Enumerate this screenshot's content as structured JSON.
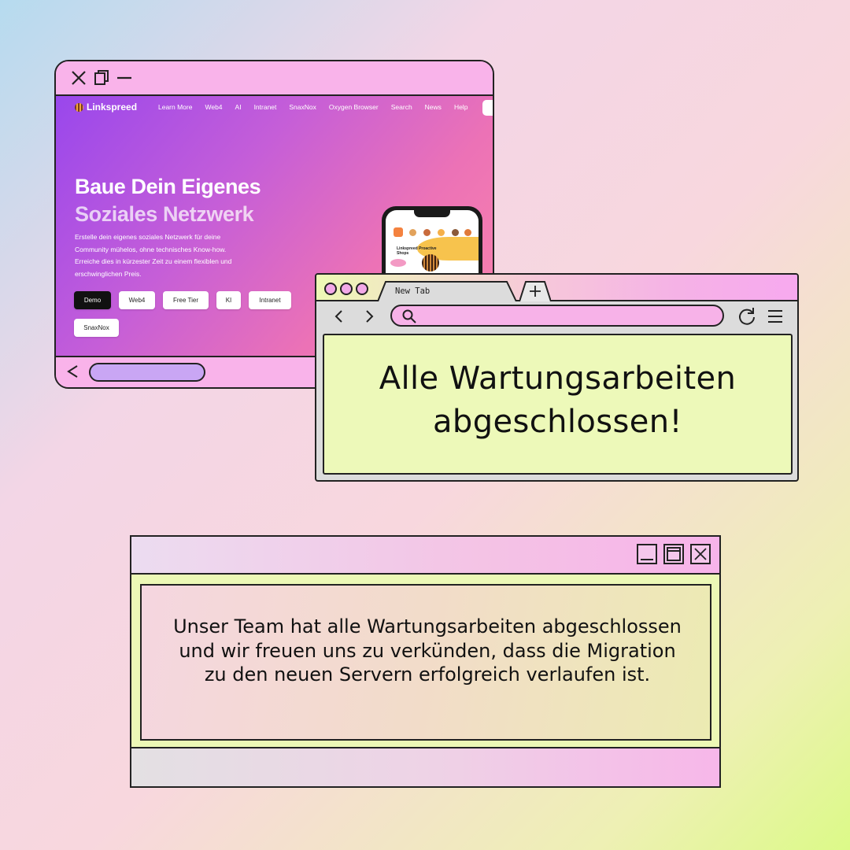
{
  "background": {
    "colors": [
      "#b6dbef",
      "#f8d7de",
      "#dcfa88"
    ]
  },
  "window_website": {
    "title_icons": [
      "close-icon",
      "restore-icon",
      "minimize-icon"
    ],
    "site": {
      "logo": "Linkspreed",
      "nav": [
        "Learn More",
        "Web4",
        "AI",
        "Intranet",
        "SnaxNox",
        "Oxygen Browser",
        "Search",
        "News",
        "Help"
      ],
      "hero_title_line1": "Baue Dein Eigenes",
      "hero_title_line2": "Soziales Netzwerk",
      "hero_text": "Erstelle dein eigenes soziales Netzwerk für deine Community mühelos, ohne technisches Know-how. Erreiche dies in kürzester Zeit zu einem flexiblen und erschwinglichen Preis.",
      "chips": [
        "Demo",
        "Web4",
        "Free Tier",
        "KI",
        "Intranet",
        "SnaxNox"
      ],
      "phone_label": "Linkspreed Proactive Shops"
    },
    "accent": "#f9b3ea",
    "scroll_color": "#c9a6f4"
  },
  "window_browser": {
    "tab_label": "New Tab",
    "new_tab_symbol": "+",
    "headline_line1": "Alle Wartungsarbeiten",
    "headline_line2": "abgeschlossen!",
    "content_color": "#edf9b9",
    "url_color": "#f7b2e8"
  },
  "window_message": {
    "controls": [
      "minimize-icon",
      "maximize-icon",
      "close-icon"
    ],
    "message": "Unser Team hat alle Wartungsarbeiten abgeschlossen und wir freuen uns zu verkünden, dass die Migration zu den neuen Servern erfolgreich verlaufen ist."
  }
}
